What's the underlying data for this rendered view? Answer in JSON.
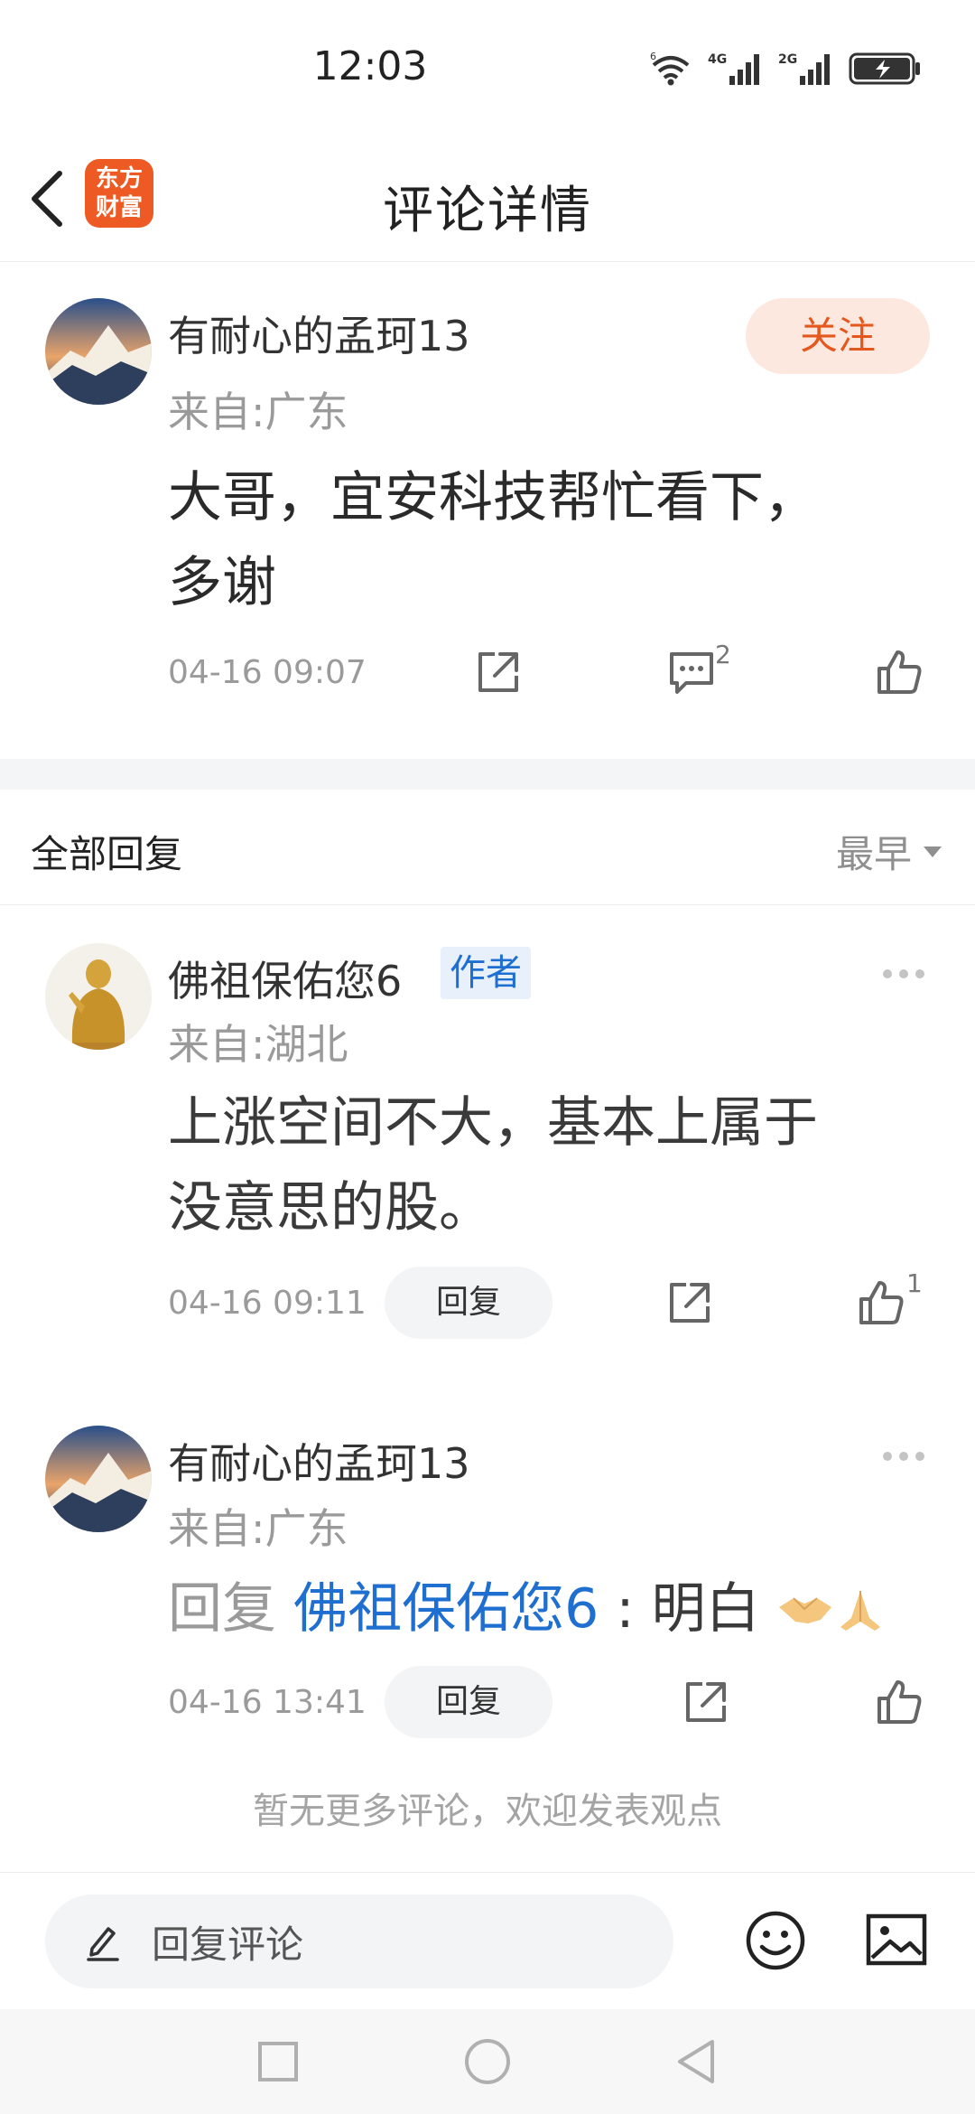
{
  "status_bar": {
    "time": "12:03",
    "net1_label": "4G",
    "net2_label": "2G",
    "wifi_label": "6"
  },
  "header": {
    "title": "评论详情",
    "logo_line1": "东方",
    "logo_line2": "财富"
  },
  "main_comment": {
    "username": "有耐心的孟珂13",
    "region": "来自:广东",
    "follow_label": "关注",
    "text_line1": "大哥，宜安科技帮忙看下，",
    "text_line2": "多谢",
    "timestamp": "04-16 09:07",
    "comment_count": "2"
  },
  "replies_section": {
    "title": "全部回复",
    "sort_label": "最早"
  },
  "replies": [
    {
      "username": "佛祖保佑您6",
      "badge": "作者",
      "region": "来自:湖北",
      "text_line1": "上涨空间不大，基本上属于",
      "text_line2": "没意思的股。",
      "timestamp": "04-16 09:11",
      "reply_label": "回复",
      "like_count": "1"
    },
    {
      "username": "有耐心的孟珂13",
      "region": "来自:广东",
      "reply_prefix": "回复 ",
      "reply_target": "佛祖保佑您6",
      "reply_text": " : 明白",
      "timestamp": "04-16 13:41",
      "reply_label": "回复"
    }
  ],
  "footer_note": "暂无更多评论，欢迎发表观点",
  "input_bar": {
    "placeholder": "回复评论"
  },
  "colors": {
    "accent_orange": "#e4581e",
    "link_blue": "#1f6fd1"
  }
}
